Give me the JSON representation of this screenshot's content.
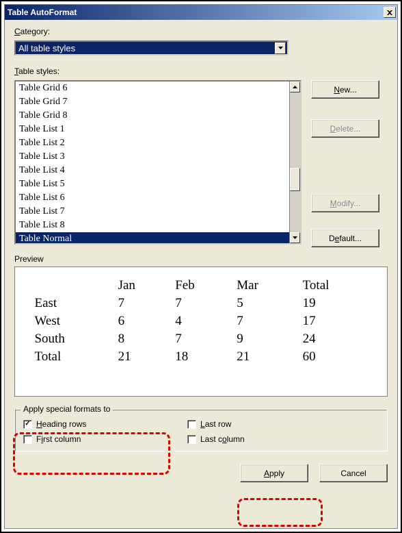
{
  "window": {
    "title": "Table AutoFormat",
    "close_x": "✕"
  },
  "category": {
    "label_pre": "C",
    "label_rest": "ategory:",
    "selected": "All table styles"
  },
  "table_styles": {
    "label_pre": "T",
    "label_rest": "able styles:",
    "items": [
      "Table Grid 6",
      "Table Grid 7",
      "Table Grid 8",
      "Table List 1",
      "Table List 2",
      "Table List 3",
      "Table List 4",
      "Table List 5",
      "Table List 6",
      "Table List 7",
      "Table List 8",
      "Table Normal"
    ],
    "selected_index": 11
  },
  "buttons": {
    "new": "New...",
    "new_u": "N",
    "new_rest": "ew...",
    "delete": "Delete...",
    "delete_u": "D",
    "delete_rest": "elete...",
    "modify": "Modify...",
    "modify_u": "M",
    "modify_rest": "odify...",
    "default": "efault...",
    "default_pre": "D",
    "default_u": "e",
    "default_rest": "fault...",
    "apply": "Apply",
    "apply_u": "A",
    "apply_rest": "pply",
    "cancel": "Cancel"
  },
  "preview": {
    "label": "Preview"
  },
  "chart_data": {
    "type": "table",
    "columns": [
      "",
      "Jan",
      "Feb",
      "Mar",
      "Total"
    ],
    "rows": [
      [
        "East",
        "7",
        "7",
        "5",
        "19"
      ],
      [
        "West",
        "6",
        "4",
        "7",
        "17"
      ],
      [
        "South",
        "8",
        "7",
        "9",
        "24"
      ],
      [
        "Total",
        "21",
        "18",
        "21",
        "60"
      ]
    ]
  },
  "special_formats": {
    "legend": "Apply special formats to",
    "heading_rows": {
      "label_u": "H",
      "label_rest": "eading rows",
      "checked": true
    },
    "last_row": {
      "pre": "",
      "u": "L",
      "rest": "ast row",
      "checked": false
    },
    "first_column": {
      "pre": "F",
      "u": "i",
      "rest": "rst column",
      "checked": false
    },
    "last_column": {
      "pre": "Last c",
      "u": "o",
      "rest": "lumn",
      "checked": false
    }
  }
}
